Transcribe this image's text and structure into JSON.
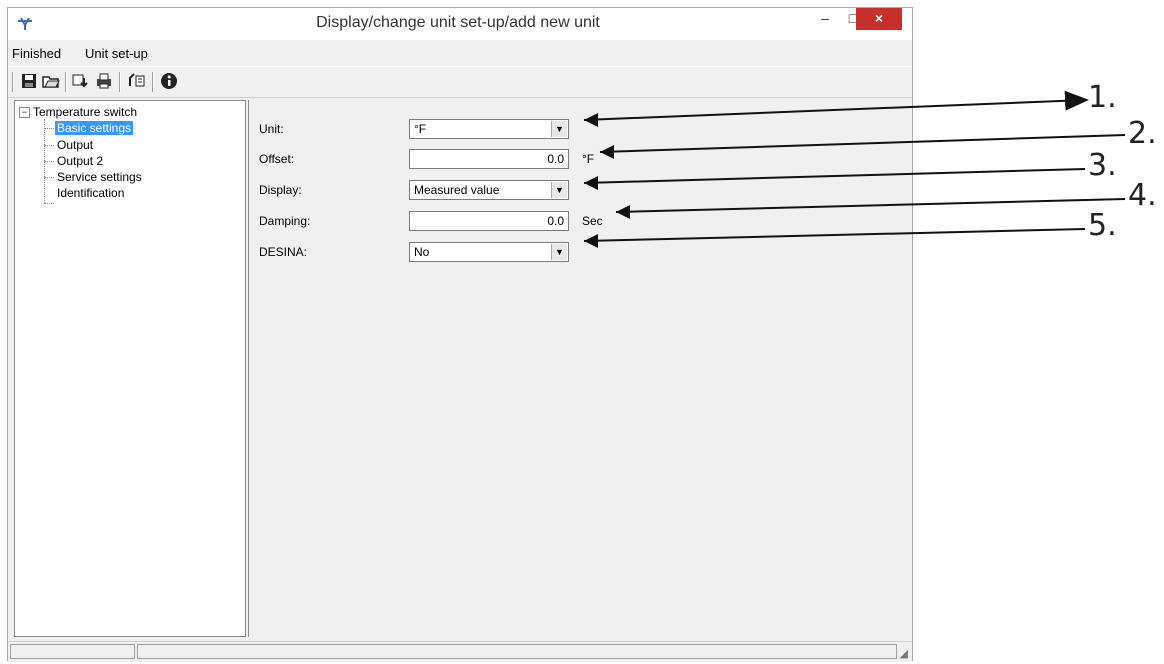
{
  "window": {
    "title": "Display/change unit set-up/add new unit",
    "minimize": "–",
    "maximize": "□",
    "close": "×"
  },
  "menu": {
    "items": [
      "Finished",
      "Unit set-up"
    ]
  },
  "toolbar": {
    "icons": [
      "save-icon",
      "open-icon",
      "download-icon",
      "print-icon",
      "transfer-icon",
      "info-icon"
    ]
  },
  "tree": {
    "root": "Temperature switch",
    "items": [
      "Basic settings",
      "Output",
      "Output 2",
      "Service settings",
      "Identification"
    ],
    "selected": "Basic settings"
  },
  "form": {
    "unit": {
      "label": "Unit:",
      "value": "°F"
    },
    "offset": {
      "label": "Offset:",
      "value": "0.0",
      "unit": "°F"
    },
    "display": {
      "label": "Display:",
      "value": "Measured value"
    },
    "damping": {
      "label": "Damping:",
      "value": "0.0",
      "unit": "Sec"
    },
    "desina": {
      "label": "DESINA:",
      "value": "No"
    }
  },
  "callouts": [
    "1.",
    "2.",
    "3.",
    "4.",
    "5."
  ]
}
